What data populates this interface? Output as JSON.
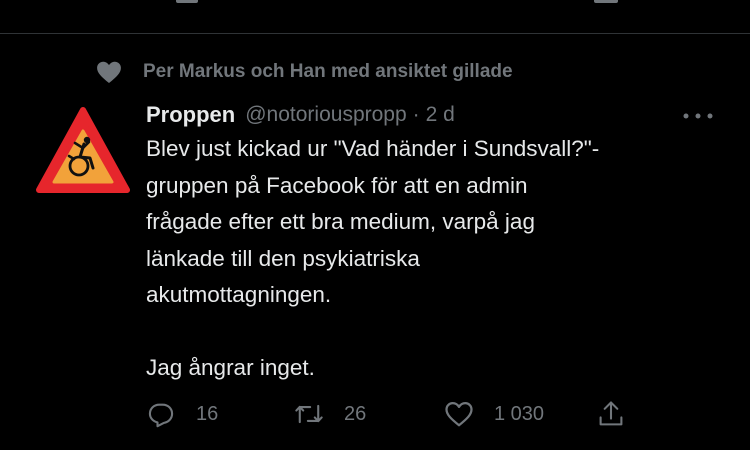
{
  "social_context": {
    "text": "Per Markus och Han med ansiktet gillade",
    "icon": "heart-icon"
  },
  "tweet": {
    "display_name": "Proppen",
    "handle": "@notoriouspropp",
    "separator": "·",
    "time": "2 d",
    "avatar_icon": "warning-sign-avatar",
    "body_lines": [
      "Blev just kickad ur \"Vad händer i Sundsvall?\"-",
      "gruppen på Facebook för att en admin",
      "frågade efter ett bra medium, varpå jag",
      "länkade till den psykiatriska",
      "akutmottagningen."
    ],
    "body_last": "Jag ångrar inget."
  },
  "actions": {
    "reply": {
      "icon": "reply-icon",
      "count": "16"
    },
    "retweet": {
      "icon": "retweet-icon",
      "count": "26"
    },
    "like": {
      "icon": "heart-icon",
      "count": "1 030"
    },
    "share": {
      "icon": "share-icon"
    },
    "more": {
      "icon": "more-icon"
    }
  },
  "colors": {
    "background": "#000000",
    "text_primary": "#e7e9ea",
    "text_secondary": "#71767b",
    "divider": "#2f3336",
    "avatar_red": "#e6262c",
    "avatar_orange": "#f2a23a"
  }
}
